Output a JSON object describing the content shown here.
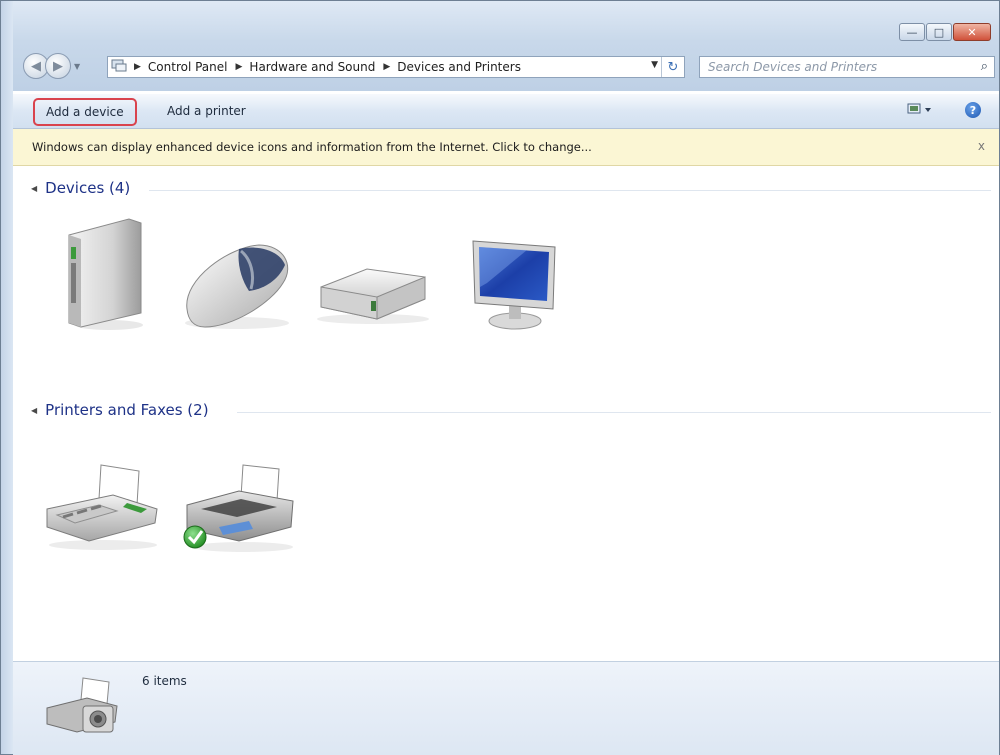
{
  "window": {
    "minimize_symbol": "—",
    "maximize_symbol": "□",
    "close_symbol": "✕"
  },
  "navigation": {
    "back_icon": "back-arrow-icon",
    "forward_icon": "forward-arrow-icon",
    "breadcrumb": [
      "Control Panel",
      "Hardware and Sound",
      "Devices and Printers"
    ],
    "search_placeholder": "Search Devices and Printers"
  },
  "toolbar": {
    "add_device_label": "Add a device",
    "add_printer_label": "Add a printer",
    "view_icon": "change-view-icon",
    "help_symbol": "?"
  },
  "infobar": {
    "message": "Windows can display enhanced device icons and information from the Internet. Click to change...",
    "close_symbol": "x"
  },
  "groups": {
    "devices": {
      "label": "Devices (4)",
      "items": [
        "external-drive-icon",
        "mouse-icon",
        "storage-device-icon",
        "monitor-icon"
      ]
    },
    "printers": {
      "label": "Printers and Faxes (2)",
      "items": [
        "fax-icon",
        "default-printer-icon"
      ]
    }
  },
  "statusbar": {
    "count_label": "6 items",
    "icon": "devices-and-printers-icon"
  },
  "colors": {
    "group_header": "#1e3287",
    "highlight_border": "#d9434d",
    "infobar_bg": "#fbf6d4",
    "default_check": "#2fa12f"
  }
}
